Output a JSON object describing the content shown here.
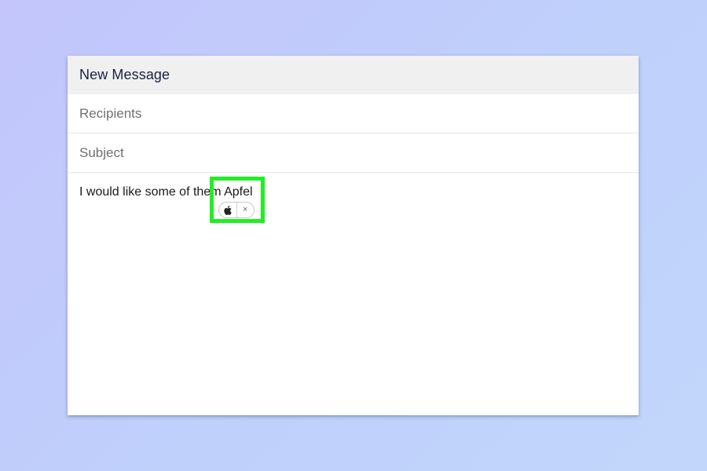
{
  "window": {
    "title": "New Message"
  },
  "compose": {
    "recipients_placeholder": "Recipients",
    "subject_placeholder": "Subject",
    "body_text": "I would like some of them Apfel"
  },
  "suggestion": {
    "icon": "apple-logo-icon",
    "close_icon": "close-icon",
    "close_glyph": "×"
  },
  "colors": {
    "highlight": "#1ff01f",
    "title_bar": "#f0f0f0",
    "background": "#c0ccfb"
  }
}
